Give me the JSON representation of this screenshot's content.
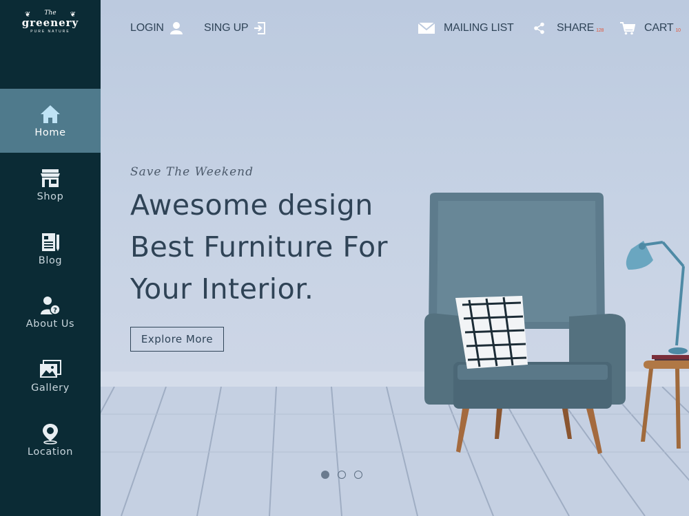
{
  "brand": {
    "the": "The",
    "name": "greenery",
    "tagline": "PURE NATURE",
    "logo_icon": "leaf-icon"
  },
  "sidebar": {
    "items": [
      {
        "label": "Home",
        "icon": "home-icon",
        "active": true
      },
      {
        "label": "Shop",
        "icon": "shop-icon",
        "active": false
      },
      {
        "label": "Blog",
        "icon": "blog-icon",
        "active": false
      },
      {
        "label": "About Us",
        "icon": "about-icon",
        "active": false
      },
      {
        "label": "Gallery",
        "icon": "gallery-icon",
        "active": false
      },
      {
        "label": "Location",
        "icon": "location-icon",
        "active": false
      }
    ]
  },
  "topbar": {
    "login": "LOGIN",
    "signup": "SING UP",
    "mailing": "MAILING LIST",
    "share": "SHARE",
    "share_badge": "128",
    "cart": "CART",
    "cart_badge": "10"
  },
  "hero": {
    "tagline": "Save The Weekend",
    "headline": [
      "Awesome design",
      "Best Furniture For",
      "Your Interior."
    ],
    "cta": "Explore More",
    "slides": 3,
    "active_slide": 1
  },
  "colors": {
    "sidebar": "#0b2b35",
    "active": "#4f7a8c",
    "text": "#2f4458",
    "accent": "#e0573c"
  }
}
